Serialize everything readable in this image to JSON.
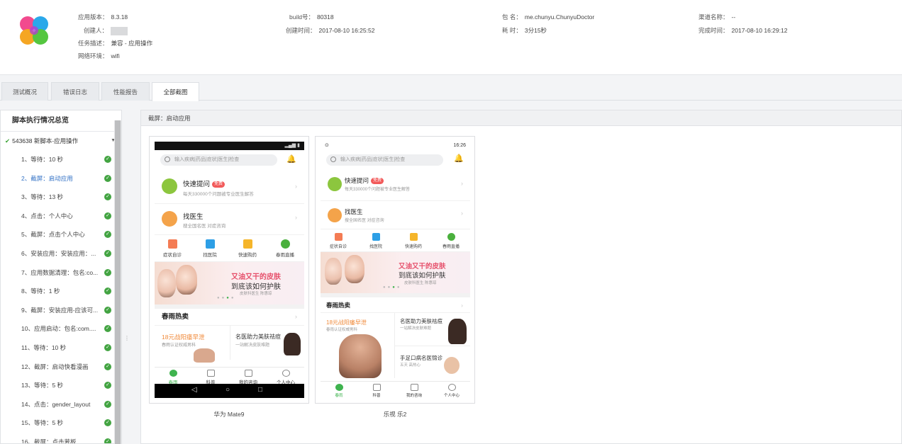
{
  "header": {
    "app_version_label": "应用版本：",
    "app_version": "8.3.18",
    "creator_label": "创建人：",
    "task_desc_label": "任务描述：",
    "task_desc": "兼容 - 应用操作",
    "network_label": "网络环境：",
    "network": "wifi",
    "build_label": "build号：",
    "build": "80318",
    "created_label": "创建时间：",
    "created": "2017-08-10 16:25:52",
    "package_label": "包 名：",
    "package": "me.chunyu.ChunyuDoctor",
    "duration_label": "耗 时：",
    "duration": "3分15秒",
    "channel_label": "渠道名称：",
    "channel": "--",
    "finished_label": "完成时间：",
    "finished": "2017-08-10 16:29:12"
  },
  "tabs": [
    "测试概况",
    "错误日志",
    "性能报告",
    "全部截图"
  ],
  "active_tab": "全部截图",
  "sidebar": {
    "title": "脚本执行情况总览",
    "script": "543638 新脚本-应用操作",
    "steps": [
      "1、等待：10 秒",
      "2、截屏：启动应用",
      "3、等待：13 秒",
      "4、点击：个人中心",
      "5、截屏：点击个人中心",
      "6、安装应用：安装应用：...",
      "7、应用数据清理：包名:co...",
      "8、等待：1 秒",
      "9、截屏：安装应用-应该可...",
      "10、应用启动：包名:com....",
      "11、等待：10 秒",
      "12、截屏：启动快看漫画",
      "13、等待：5 秒",
      "14、点击：gender_layout",
      "15、等待：5 秒",
      "16、截屏：点击萝板"
    ],
    "selected_index": 1
  },
  "panel": {
    "title": "截屏：启动应用",
    "devices": [
      {
        "name": "华为 Mate9"
      },
      {
        "name": "乐视 乐2"
      }
    ]
  },
  "phone": {
    "status_time": "16:26",
    "search_placeholder": "输入疾病|药品|症状|医生|检查",
    "quick_ask": "快速提问",
    "quick_ask_badge": "免费",
    "quick_ask_sub": "每天330000个问题被专业医生解答",
    "find_doctor": "找医生",
    "find_doctor_sub": "搜全国名医 对症咨询",
    "quick_links": [
      "症状自诊",
      "找医院",
      "快速购药",
      "春雨直播"
    ],
    "banner_title": "又油又干的皮肤",
    "banner_sub": "到底该如何护肤",
    "banner_tiny": "皮肤科医生 陈惠琼",
    "hot_title": "春雨热卖",
    "promo1": "18元战阳痿早泄",
    "promo1_sub": "春雨认证权威男科",
    "promo2": "名医助力美肤祛痘",
    "promo2_sub": "一站解决皮肤难题",
    "promo3": "手足口病名医锦诊",
    "promo3_sub": "五天 高热心",
    "tabbar": [
      "春雨",
      "科普",
      "我的咨询",
      "个人中心"
    ]
  },
  "colors": {
    "accent_green": "#3fb34f",
    "link_blue": "#2f6fc4",
    "badge_red": "#f25a5a",
    "banner_pink": "#e64f6a",
    "promo_orange": "#f08a3a"
  }
}
